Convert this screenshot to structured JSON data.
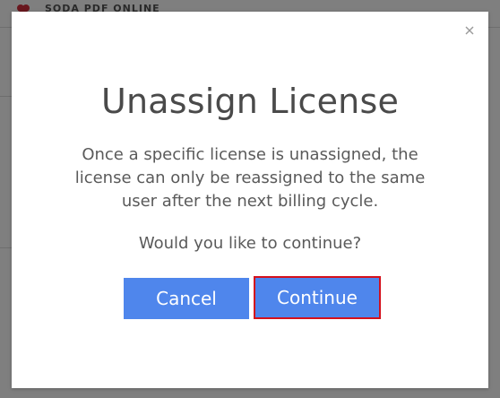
{
  "background": {
    "brand": "SODA PDF ONLINE"
  },
  "modal": {
    "close_glyph": "×",
    "title": "Unassign License",
    "body": "Once a specific license is unassigned, the license can only be reassigned to the same user after the next billing cycle.",
    "question": "Would you like to continue?",
    "cancel_label": "Cancel",
    "continue_label": "Continue"
  },
  "colors": {
    "button_bg": "#4f86ec",
    "highlight_border": "#d4111d",
    "overlay": "rgba(0,0,0,0.5)"
  }
}
